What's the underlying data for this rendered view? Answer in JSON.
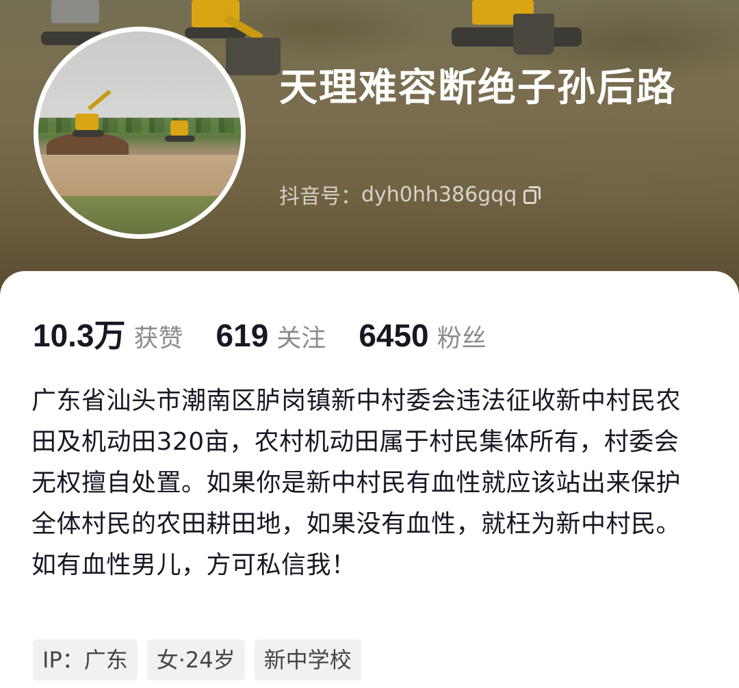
{
  "profile": {
    "name": "天理难容断绝子孙后路",
    "douyin_id_label": "抖音号：",
    "douyin_id": "dyh0hh386gqq"
  },
  "stats": [
    {
      "value": "10.3万",
      "label": "获赞"
    },
    {
      "value": "619",
      "label": "关注"
    },
    {
      "value": "6450",
      "label": "粉丝"
    }
  ],
  "bio": "广东省汕头市潮南区胪岗镇新中村委会违法征收新中村民农田及机动田320亩，农村机动田属于村民集体所有，村委会无权擅自处置。如果你是新中村民有血性就应该站出来保护全体村民的农田耕田地，如果没有血性，就枉为新中村民。如有血性男儿，方可私信我！",
  "tags": [
    "IP：广东",
    "女·24岁",
    "新中学校"
  ],
  "icons": {
    "copy": "copy-icon"
  },
  "colors": {
    "text_primary": "#161823",
    "text_secondary": "#8a8b91",
    "tag_bg": "#f1f1f3"
  }
}
